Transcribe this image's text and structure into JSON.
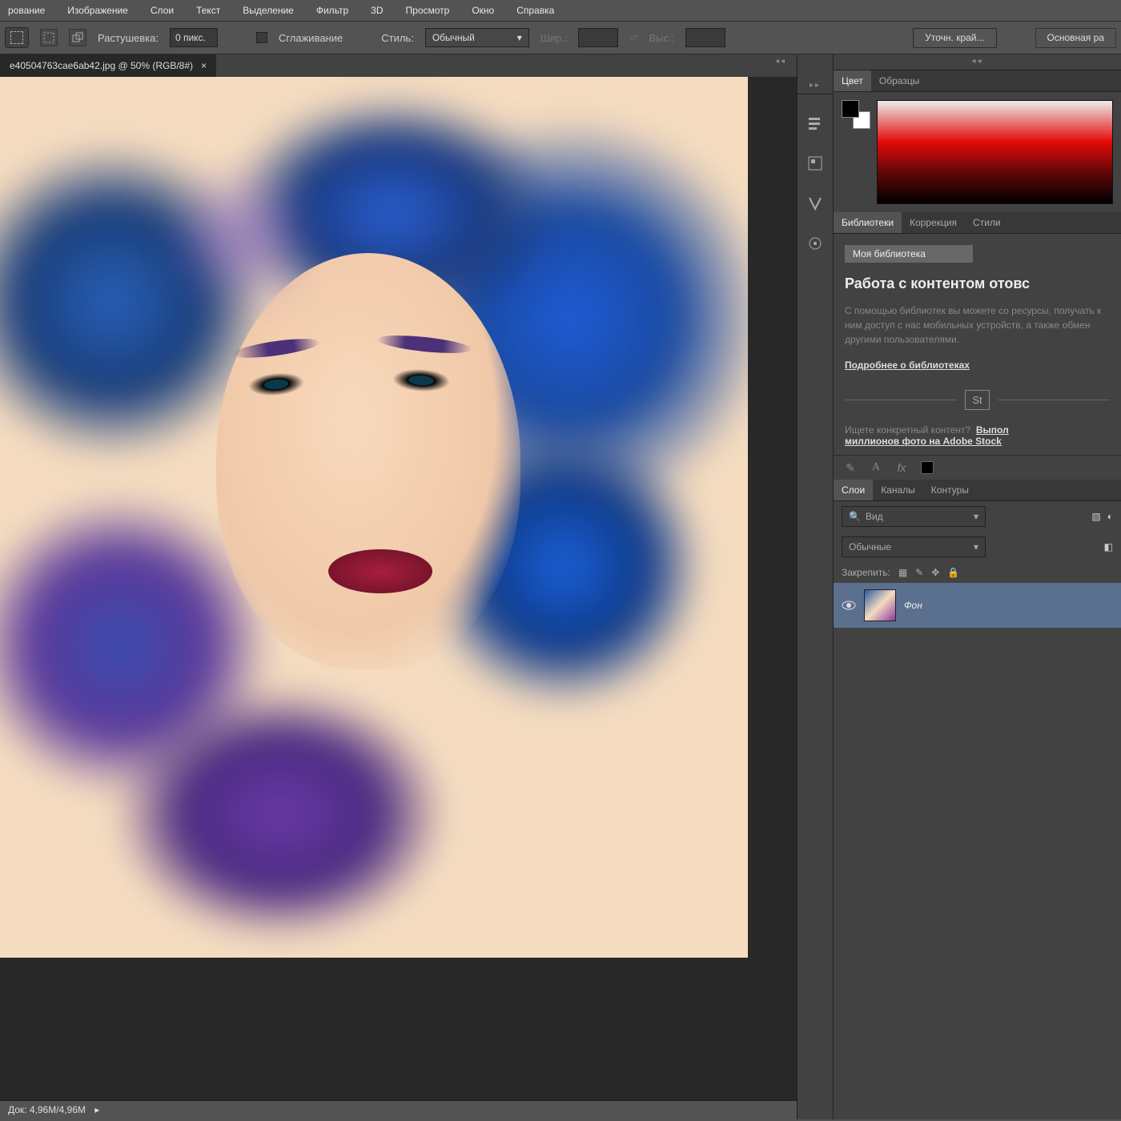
{
  "menu": [
    "рование",
    "Изображение",
    "Слои",
    "Текст",
    "Выделение",
    "Фильтр",
    "3D",
    "Просмотр",
    "Окно",
    "Справка"
  ],
  "options": {
    "feather_label": "Растушевка:",
    "feather_value": "0 пикс.",
    "antialias": "Сглаживание",
    "style_label": "Стиль:",
    "style_value": "Обычный",
    "width_label": "Шир.:",
    "height_label": "Выс.:",
    "refine": "Уточн. край...",
    "workspace": "Основная ра"
  },
  "document": {
    "tab": "e40504763cae6ab42.jpg @ 50% (RGB/8#)",
    "status": "Док: 4,96M/4,96M"
  },
  "panel_tabs": {
    "color": "Цвет",
    "swatches": "Образцы",
    "libraries": "Библиотеки",
    "adjustments": "Коррекция",
    "styles": "Стили",
    "layers": "Слои",
    "channels": "Каналы",
    "paths": "Контуры"
  },
  "libraries": {
    "my_lib": "Моя библиотека",
    "title": "Работа с контентом отовс",
    "body": "С помощью библиотек вы можете со ресурсы, получать к ним доступ с нас мобильных устройств, а также обмен другими пользователями.",
    "learn_more": "Подробнее о библиотеках",
    "stock_badge": "St",
    "stock_q": "Ищете конкретный контент?",
    "stock_link1": "Выпол",
    "stock_link2": "миллионов фото на Adobe Stock"
  },
  "layers": {
    "filter_kind": "Вид",
    "blend_mode": "Обычные",
    "lock_label": "Закрепить:",
    "bg_name": "Фон"
  }
}
